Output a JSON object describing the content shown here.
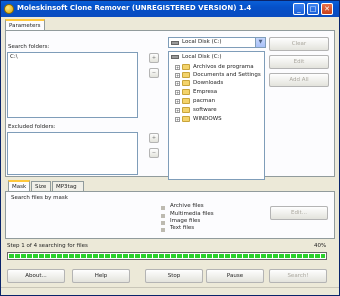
{
  "window": {
    "title": "Moleskinsoft Clone Remover (UNREGISTERED VERSION) 1.4",
    "controls": {
      "minimize": "_",
      "maximize": "□",
      "close": "✕"
    }
  },
  "top_tabs": [
    {
      "label": "Parameters"
    }
  ],
  "left_panel": {
    "search_label": "Search folders:",
    "search_items": [
      "C:\\"
    ],
    "exclude_label": "Excluded folders:"
  },
  "drive_combo": {
    "value": "Local Disk (C:)"
  },
  "tree": {
    "root": "Local Disk (C:)",
    "items": [
      "Archivos de programa",
      "Documents and Settings",
      "Downloads",
      "Empresa",
      "pacman",
      "software",
      "WINDOWS"
    ]
  },
  "right_buttons": {
    "clear": "Clear",
    "edit": "Edit",
    "add_all": "Add All"
  },
  "bottom_tabs": [
    {
      "label": "Mask"
    },
    {
      "label": "Size"
    },
    {
      "label": "MP3tag"
    }
  ],
  "mask_panel": {
    "label": "Search files by mask",
    "list": [
      "Archive files",
      "Multimedia files",
      "Image files",
      "Text files"
    ],
    "edit_button": "Edit..."
  },
  "progress": {
    "status": "Step 1 of 4 searching for files",
    "percent_text": "40%",
    "percent": 40
  },
  "buttons": {
    "about": "About...",
    "help": "Help",
    "stop": "Stop",
    "pause": "Pause",
    "search": "Search!"
  },
  "colors": {
    "titlebar": "#0550c8",
    "progress": "#2bd12b",
    "tab_highlight": "#ffc83c"
  }
}
